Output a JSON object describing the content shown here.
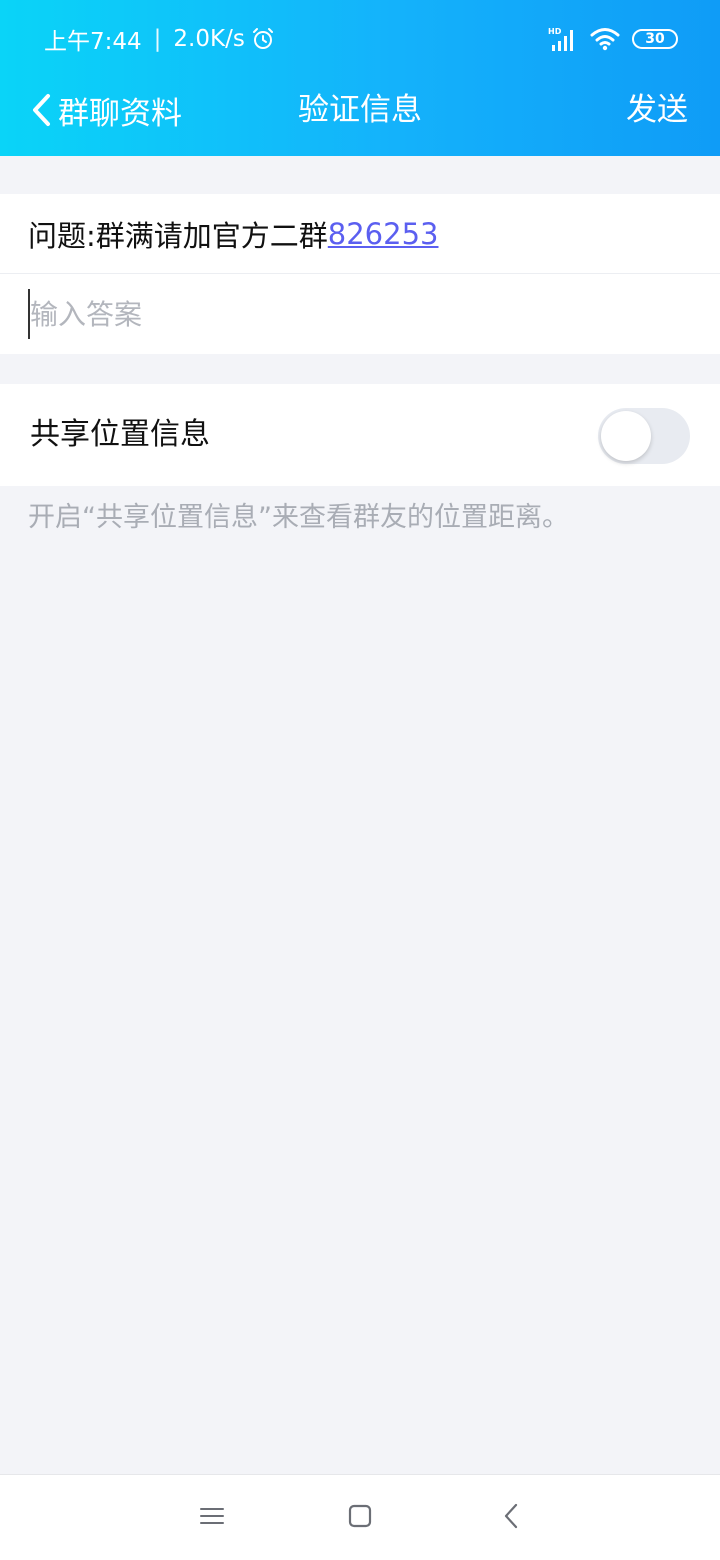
{
  "status_bar": {
    "time": "上午7:44",
    "separator": "|",
    "net_speed": "2.0K/s",
    "battery_level": "30",
    "icons": [
      "alarm-icon",
      "hd-signal-icon",
      "wifi-icon",
      "battery-icon"
    ]
  },
  "nav": {
    "back_label": "群聊资料",
    "title": "验证信息",
    "send_label": "发送"
  },
  "question": {
    "prefix": "问题:群满请加官方二群",
    "link_number": "826253"
  },
  "answer": {
    "placeholder": "输入答案",
    "value": ""
  },
  "location": {
    "label": "共享位置信息",
    "toggle_on": false,
    "hint": "开启“共享位置信息”来查看群友的位置距离。"
  },
  "system_nav": {
    "icons": [
      "menu-icon",
      "home-icon",
      "back-icon"
    ]
  },
  "colors": {
    "header_gradient_start": "#0ad4f8",
    "header_gradient_end": "#0f9cf7",
    "link": "#5b5ff0",
    "background": "#f3f4f8",
    "hint_text": "#a9adb5"
  }
}
